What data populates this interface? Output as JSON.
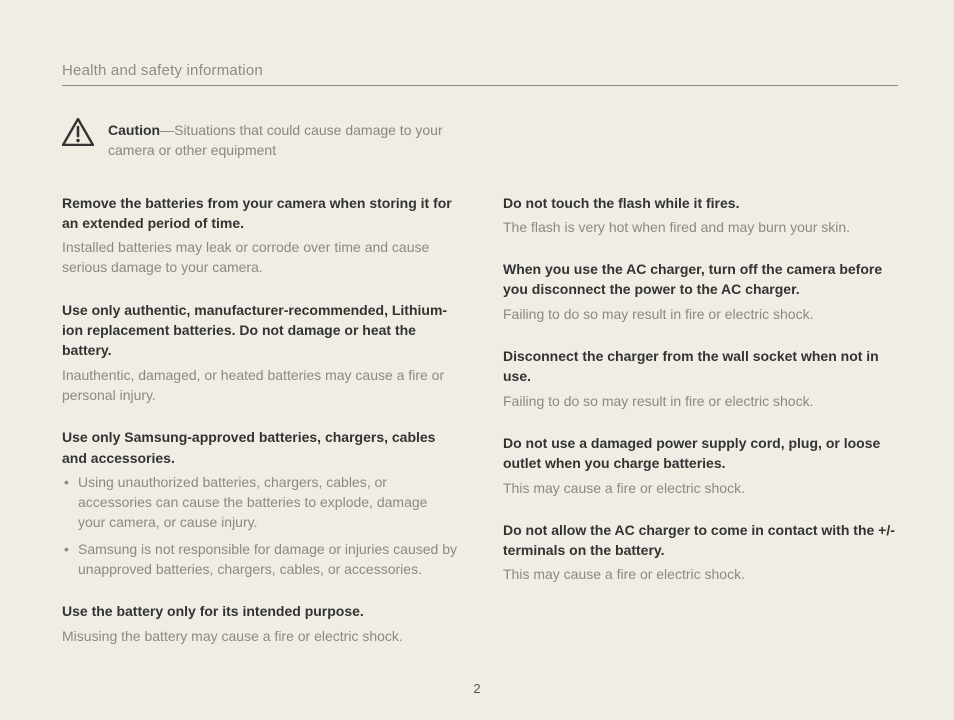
{
  "header": {
    "title": "Health and safety information"
  },
  "caution": {
    "label": "Caution",
    "text": "—Situations that could cause damage to your camera or other equipment"
  },
  "left": {
    "s1": {
      "h": "Remove the batteries from your camera when storing it for an extended period of time.",
      "b": "Installed batteries may leak or corrode over time and cause serious damage to your camera."
    },
    "s2": {
      "h": "Use only authentic, manufacturer-recommended, Lithium-ion replacement batteries. Do not damage or heat the battery.",
      "b": "Inauthentic, damaged, or heated batteries may cause a fire or personal injury."
    },
    "s3": {
      "h": "Use only Samsung-approved batteries, chargers, cables and accessories.",
      "bul": [
        "Using unauthorized batteries, chargers, cables, or accessories can cause the batteries to explode, damage your camera, or cause injury.",
        "Samsung is not responsible for damage or injuries caused by unapproved batteries, chargers, cables, or accessories."
      ]
    },
    "s4": {
      "h": "Use the battery only for its intended purpose.",
      "b": "Misusing the battery may cause a fire or electric shock."
    }
  },
  "right": {
    "s1": {
      "h": "Do not touch the flash while it fires.",
      "b": "The flash is very hot when fired and may burn your skin."
    },
    "s2": {
      "h": "When you use the AC charger, turn off the camera before you disconnect the power to the AC charger.",
      "b": "Failing to do so may result in fire or electric shock."
    },
    "s3": {
      "h": "Disconnect the charger from the wall socket when not in use.",
      "b": "Failing to do so may result in fire or electric shock."
    },
    "s4": {
      "h": "Do not use a damaged power supply cord, plug, or loose outlet when you charge batteries.",
      "b": "This may cause a fire or electric shock."
    },
    "s5": {
      "h": "Do not allow the AC charger to come in contact with the +/- terminals on the battery.",
      "b": "This may cause a fire or electric shock."
    }
  },
  "page_number": "2"
}
